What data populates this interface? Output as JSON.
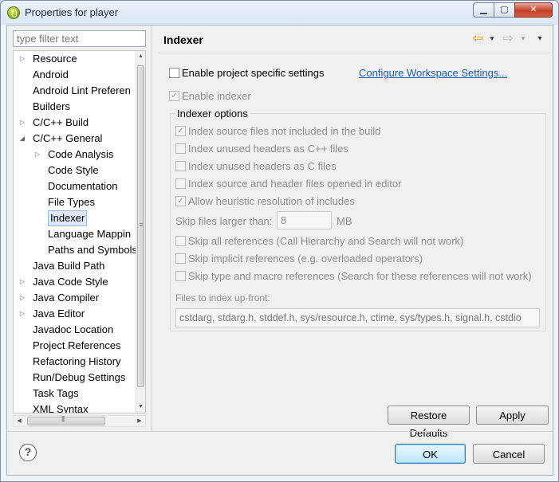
{
  "window": {
    "title": "Properties for player",
    "min_icon": "minimize-icon",
    "max_icon": "maximize-icon",
    "close_icon": "close-icon"
  },
  "filter": {
    "placeholder": "type filter text"
  },
  "tree": {
    "items": [
      {
        "label": "Resource",
        "expander": "▷"
      },
      {
        "label": "Android",
        "expander": ""
      },
      {
        "label": "Android Lint Preferen",
        "expander": ""
      },
      {
        "label": "Builders",
        "expander": ""
      },
      {
        "label": "C/C++ Build",
        "expander": "▷"
      },
      {
        "label": "C/C++ General",
        "expander": "◢"
      },
      {
        "label": "Code Analysis",
        "expander": "▷"
      },
      {
        "label": "Code Style",
        "expander": ""
      },
      {
        "label": "Documentation",
        "expander": ""
      },
      {
        "label": "File Types",
        "expander": ""
      },
      {
        "label": "Indexer",
        "expander": ""
      },
      {
        "label": "Language Mappin",
        "expander": ""
      },
      {
        "label": "Paths and Symbols",
        "expander": ""
      },
      {
        "label": "Java Build Path",
        "expander": ""
      },
      {
        "label": "Java Code Style",
        "expander": "▷"
      },
      {
        "label": "Java Compiler",
        "expander": "▷"
      },
      {
        "label": "Java Editor",
        "expander": "▷"
      },
      {
        "label": "Javadoc Location",
        "expander": ""
      },
      {
        "label": "Project References",
        "expander": ""
      },
      {
        "label": "Refactoring History",
        "expander": ""
      },
      {
        "label": "Run/Debug Settings",
        "expander": ""
      },
      {
        "label": "Task Tags",
        "expander": ""
      },
      {
        "label": "XML Syntax",
        "expander": ""
      }
    ],
    "selected": "Indexer"
  },
  "page": {
    "title": "Indexer",
    "nav": {
      "back_icon": "⇦",
      "forward_icon": "⇨",
      "menu_icon": "▼",
      "dropdown_icon": "▾"
    },
    "enable_project_specific": {
      "label": "Enable project specific settings",
      "checked": false
    },
    "configure_link": "Configure Workspace Settings...",
    "enable_indexer": {
      "label": "Enable indexer",
      "checked": true
    },
    "group_title": "Indexer options",
    "options": [
      {
        "label": "Index source files not included in the build",
        "checked": true
      },
      {
        "label": "Index unused headers as C++ files",
        "checked": false
      },
      {
        "label": "Index unused headers as C files",
        "checked": false
      },
      {
        "label": "Index source and header files opened in editor",
        "checked": false
      },
      {
        "label": "Allow heuristic resolution of includes",
        "checked": true
      }
    ],
    "skip_files_label": "Skip files larger than:",
    "skip_files_value": "8",
    "skip_files_unit": "MB",
    "skip_options": [
      {
        "label": "Skip all references (Call Hierarchy and Search will not work)",
        "checked": false
      },
      {
        "label": "Skip implicit references (e.g. overloaded operators)",
        "checked": false
      },
      {
        "label": "Skip type and macro references (Search for these references will not work)",
        "checked": false
      }
    ],
    "files_upfront_label": "Files to index up-front:",
    "files_upfront_value": "cstdarg, stdarg.h, stddef.h, sys/resource.h, ctime, sys/types.h, signal.h, cstdio",
    "restore_defaults": "Restore Defaults",
    "apply": "Apply"
  },
  "footer": {
    "help_icon": "?",
    "ok": "OK",
    "cancel": "Cancel"
  }
}
